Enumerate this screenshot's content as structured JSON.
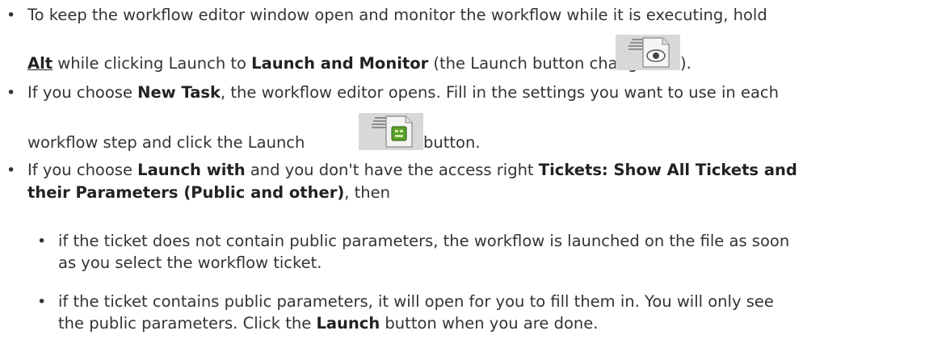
{
  "items": [
    {
      "l1a": "To keep the workflow editor window open and monitor the workflow while it is executing, hold",
      "l2_alt": "Alt",
      "l2_a": " while clicking Launch to ",
      "l2_bold": "Launch and Monitor",
      "l2_b": " (the Launch button changes to ",
      "l2_c": ").",
      "icon": "launch-and-monitor-icon"
    },
    {
      "l1_a": "If you choose ",
      "l1_bold": "New Task",
      "l1_b": ", the workflow editor opens. Fill in the settings you want to use in each",
      "l2_a": "workflow step and click the Launch ",
      "l2_b": " button.",
      "icon": "launch-icon"
    },
    {
      "l1_a": "If you choose ",
      "l1_bold1": "Launch with",
      "l1_b": " and you don't have the access right ",
      "l1_bold2": "Tickets: Show All Tickets and",
      "l2_bold": "their Parameters (Public and other)",
      "l2_a": ", then"
    }
  ],
  "subitems": [
    {
      "l1": "if the ticket does not contain public parameters, the workflow is launched on the file as soon",
      "l2": "as you select the workflow ticket."
    },
    {
      "l1": "if the ticket contains public parameters, it will open for you to fill them in. You will only see",
      "l2_a": "the public parameters. Click the ",
      "l2_bold": "Launch",
      "l2_b": " button when you are done."
    }
  ]
}
